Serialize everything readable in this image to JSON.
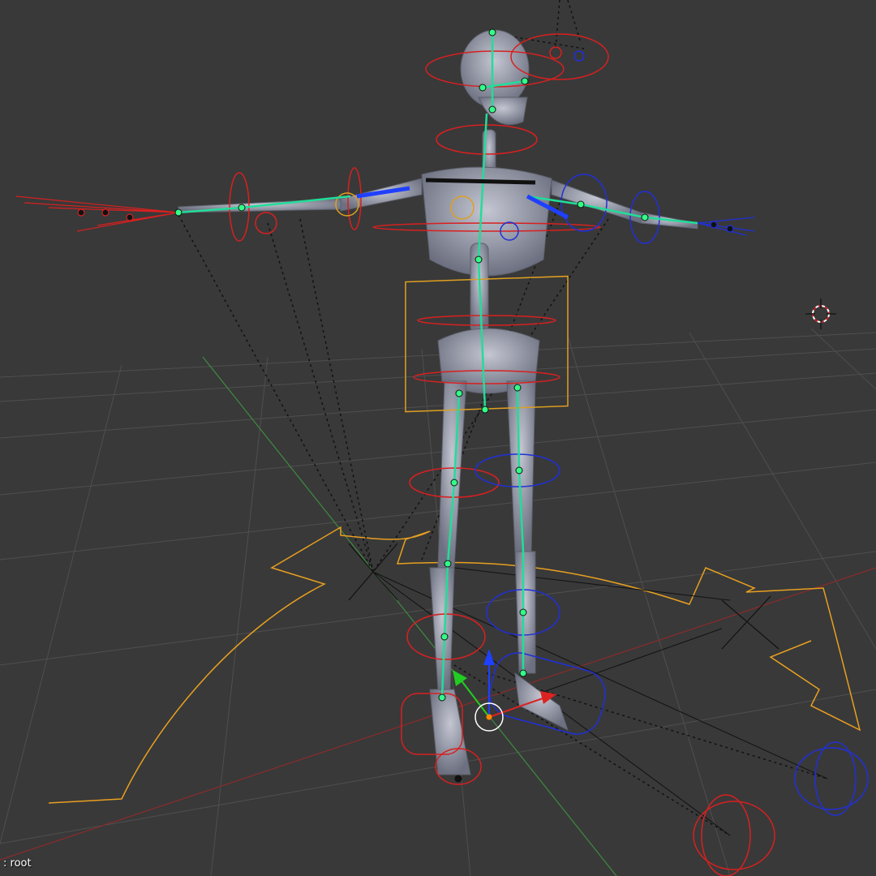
{
  "viewport": {
    "active_object_label": ": root",
    "background_color": "#393939"
  },
  "colors": {
    "grid": "#4f4f4f",
    "x_axis": "#8a2b2b",
    "y_axis": "#3f8a3f",
    "bone": "#22dd99",
    "bone_joint": "#33ff88",
    "control_left": "#d82020",
    "control_right": "#2030d8",
    "control_center": "#e0a020",
    "root_outline": "#e8a020",
    "cursor_ring": "#cc2222",
    "skeleton_fill": "#8c8f9c"
  },
  "icons": [
    "3d-cursor-icon",
    "transform-gizmo-icon",
    "empty-cross-icon"
  ]
}
